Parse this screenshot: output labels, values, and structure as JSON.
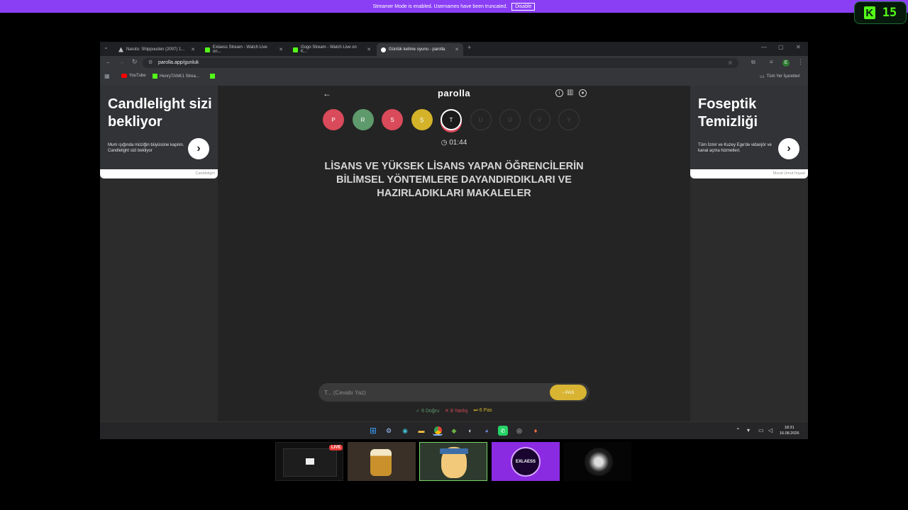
{
  "banner": {
    "message": "Streamer Mode is enabled. Usernames have been truncated.",
    "disable_label": "Disable"
  },
  "kick_badge": {
    "letter": "K",
    "count": "15"
  },
  "browser": {
    "tabs": [
      {
        "title": "Naruto: Shippuuden (2007) 1...",
        "favicon_color": "#bdbdbd"
      },
      {
        "title": "Exlaess Stream - Watch Live on...",
        "favicon_color": "#53fc18"
      },
      {
        "title": "Gogo Stream - Watch Live on K...",
        "favicon_color": "#53fc18"
      },
      {
        "title": "Günlük kelime oyunu - parolla",
        "favicon_color": "#ffffff"
      }
    ],
    "url": "parolla.app/gunluk",
    "bookmarks": [
      {
        "label": "YouTube",
        "favicon_color": "#ff0000"
      },
      {
        "label": "HenryTANK1 Strea...",
        "favicon_color": "#53fc18"
      }
    ],
    "all_bookmarks_label": "Tüm Yer İşaretleri",
    "profile_initial": "E"
  },
  "ads": {
    "left": {
      "title": "Candlelight sizi bekliyor",
      "description": "Mum ışığında müziğin büyüsüne kapılın. Candlelight sizi bekliyor",
      "footer": "Candlelight"
    },
    "right": {
      "title": "Foseptik Temizliği",
      "description": "Tüm İzmir ve Kuzey Ege'de vidanjör ve kanal açma hizmetleri.",
      "footer": "Murat Umut İnşaat"
    }
  },
  "game": {
    "logo": "parolla",
    "letters": [
      {
        "char": "P",
        "state": "red"
      },
      {
        "char": "R",
        "state": "green"
      },
      {
        "char": "S",
        "state": "red"
      },
      {
        "char": "Ş",
        "state": "yellow"
      },
      {
        "char": "T",
        "state": "current"
      },
      {
        "char": "U",
        "state": "empty"
      },
      {
        "char": "Ü",
        "state": "empty"
      },
      {
        "char": "V",
        "state": "empty"
      },
      {
        "char": "Y",
        "state": "empty"
      }
    ],
    "timer": "01:44",
    "question": "LİSANS VE YÜKSEK LİSANS YAPAN ÖĞRENCİLERİN BİLİMSEL YÖNTEMLERE DAYANDIRDIKLARI VE HAZIRLADIKLARI MAKALELER",
    "answer_placeholder": "T... (Cevabı Yaz)",
    "pas_label": "PAS",
    "stats": {
      "correct": "6 Doğru",
      "wrong": "8 Yanlış",
      "pass": "6 Pas"
    }
  },
  "taskbar": {
    "time": "18:31",
    "date": "16.08.2026"
  },
  "cams": {
    "live_label": "LIVE",
    "exlaess_label": "EXLAESS"
  },
  "colors": {
    "banner": "#8b3ff5",
    "kick_green": "#53fc18",
    "wrong": "#d94a5a",
    "correct": "#5e9a6c",
    "pass": "#d4b32a"
  }
}
